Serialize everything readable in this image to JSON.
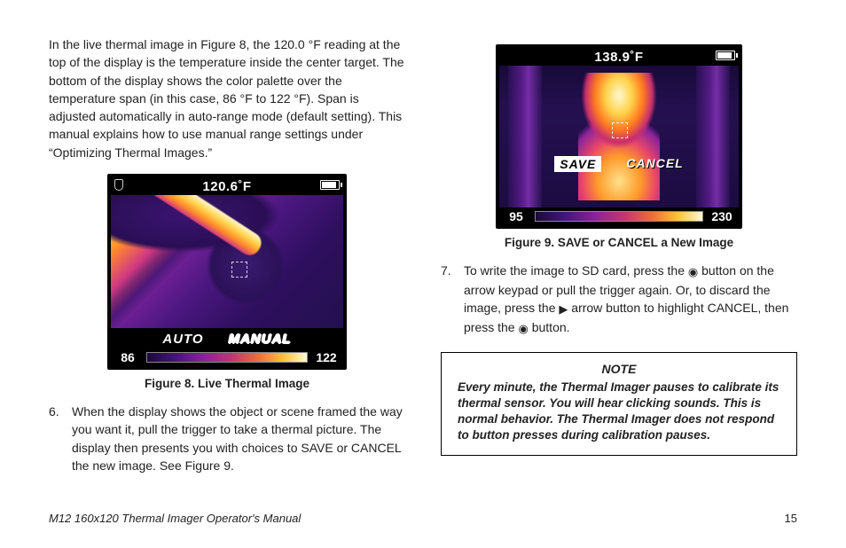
{
  "leftIntro": "In the live thermal image in Figure 8, the 120.0 °F reading at the top of the display is the temperature inside the center target. The bottom of the display shows the color palette over the temperature span (in this case, 86 °F to 122 °F). Span is adjusted automatically in auto-range mode (default setting). This manual explains how to use manual range settings under “Optimizing Thermal Images.”",
  "fig8": {
    "caption": "Figure 8. Live Thermal Image",
    "temp": "120.6˚F",
    "modeAuto": "AUTO",
    "modeManual": "MANUAL",
    "low": "86",
    "high": "122"
  },
  "step6": {
    "num": "6.",
    "text": "When the display shows the object or scene framed the way you want it, pull the trigger to take a thermal picture. The display then presents you with choices to SAVE or CANCEL the new image. See Figure 9."
  },
  "fig9": {
    "caption": "Figure 9. SAVE or CANCEL a New Image",
    "temp": "138.9˚F",
    "save": "SAVE",
    "cancel": "CANCEL",
    "low": "95",
    "high": "230"
  },
  "step7": {
    "num": "7.",
    "textA": "To write the image to SD card, press the ",
    "textB": " button on the arrow keypad or pull the trigger again. Or, to discard the image, press the ",
    "textC": " arrow button to highlight CANCEL, then press the ",
    "textD": " button."
  },
  "glyphs": {
    "enter": "◉",
    "right": "▶"
  },
  "note": {
    "title": "NOTE",
    "body": "Every minute, the Thermal Imager pauses to calibrate its thermal sensor. You will hear clicking sounds. This is normal behavior. The Thermal Imager does not respond to button presses during calibration pauses."
  },
  "footer": {
    "manual": "M12 160x120 Thermal Imager Operator's Manual",
    "page": "15"
  }
}
